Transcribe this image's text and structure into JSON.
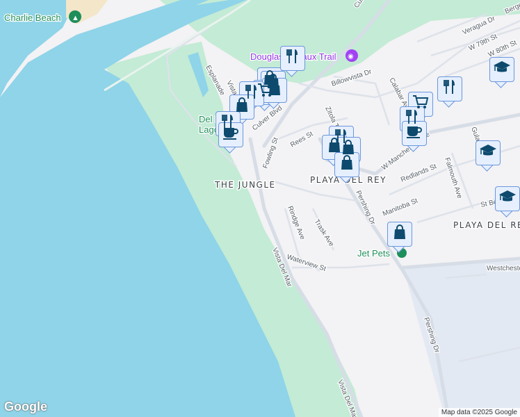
{
  "map": {
    "pois": {
      "charlie_beach": "Charlie Beach",
      "trail": "Douglas Devaux Trail",
      "lagoon_line1": "Del Rey",
      "lagoon_line2": "Lagoon",
      "jet_pets": "Jet Pets"
    },
    "neighborhoods": {
      "jungle": "THE JUNGLE",
      "playa1": "PLAYA DEL REY",
      "playa2": "PLAYA DEL REY"
    },
    "streets": {
      "culver_top": "Culver Blvd",
      "culver": "Culver Blvd",
      "esplanade": "Esplanade",
      "vista_short": "Vista Del Mar",
      "billowvista": "Billowvista Dr",
      "calabar": "Calabar Ave",
      "zitola": "Zitola Ter",
      "rees": "Rees St",
      "fowling": "Fowling St",
      "manchester": "W Manchester Ave",
      "pershing1": "Pershing Dr",
      "pershing2": "Pershing Dr",
      "rindge": "Rindge Ave",
      "trask": "Trask Ave",
      "waterview": "Waterview St",
      "vista1": "Vista Del Mar",
      "vista2": "Vista Del Mar",
      "redlands": "Redlands St",
      "falmouth": "Falmouth Ave",
      "manitoba": "Manitoba St",
      "st_b": "St Bernard St",
      "gulana": "Gulana Ave",
      "veragua": "Veragua Dr",
      "w79": "W 79th St",
      "w80": "W 80th St",
      "berger": "Berger Ave",
      "westchester": "Westchester Pkwy"
    },
    "markers": [
      {
        "type": "shopping-bag"
      },
      {
        "type": "shopping-bag"
      },
      {
        "type": "shopping-cart"
      },
      {
        "type": "shopping-bag"
      },
      {
        "type": "restaurant"
      },
      {
        "type": "shopping-bag"
      },
      {
        "type": "restaurant"
      },
      {
        "type": "cafe"
      },
      {
        "type": "restaurant"
      },
      {
        "type": "restaurant"
      },
      {
        "type": "shopping-bag"
      },
      {
        "type": "shopping-bag"
      },
      {
        "type": "shopping-bag"
      },
      {
        "type": "restaurant"
      },
      {
        "type": "shopping-cart"
      },
      {
        "type": "restaurant"
      },
      {
        "type": "cafe"
      },
      {
        "type": "school"
      },
      {
        "type": "school"
      },
      {
        "type": "school"
      },
      {
        "type": "shopping-bag"
      }
    ],
    "colors": {
      "water": "#8fd4e8",
      "park": "#c3ebd5",
      "land": "#f3f2f4",
      "road": "#d7dde6",
      "marker_fill": "#e6effd",
      "marker_icon": "#0d4a6e"
    }
  },
  "footer": {
    "logo": "Google",
    "attribution": "Map data ©2025 Google"
  }
}
